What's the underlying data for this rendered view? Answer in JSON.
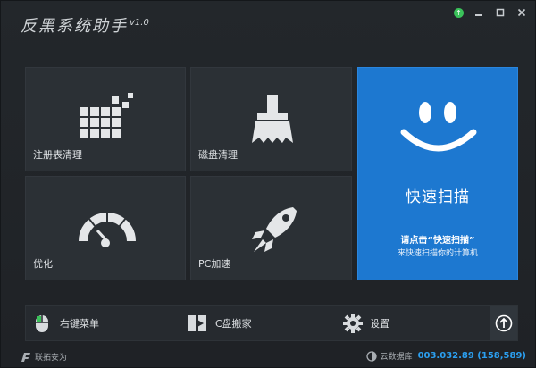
{
  "app": {
    "title": "反黑系统助手",
    "version": "v1.0"
  },
  "window_controls": {
    "upgrade_icon": "arrow-up-icon",
    "minimize": "▬",
    "maximize": "▫",
    "close": "✕"
  },
  "tiles": {
    "registry": {
      "label": "注册表清理",
      "icon": "grid-blocks-icon"
    },
    "disk": {
      "label": "磁盘清理",
      "icon": "broom-icon"
    },
    "optimize": {
      "label": "优化",
      "icon": "gauge-icon"
    },
    "pc_speed": {
      "label": "PC加速",
      "icon": "rocket-icon"
    },
    "quick_scan": {
      "title": "快速扫描",
      "hint": "请点击“快速扫描”",
      "sub": "来快速扫描你的计算机",
      "icon": "smiley-icon"
    }
  },
  "toolbar": {
    "context_menu": "右键菜单",
    "c_drive_move": "C盘搬家",
    "settings": "设置",
    "up_icon": "circle-arrow-up-icon"
  },
  "status": {
    "brand": "联拓安为",
    "cloud_label": "云数据库",
    "cloud_count": "003.032.89 (158,589)"
  },
  "colors": {
    "accent_blue": "#1d78d0",
    "bg_dark": "#222529",
    "tile_bg": "#2b3035",
    "count_blue": "#2b9ff0"
  }
}
